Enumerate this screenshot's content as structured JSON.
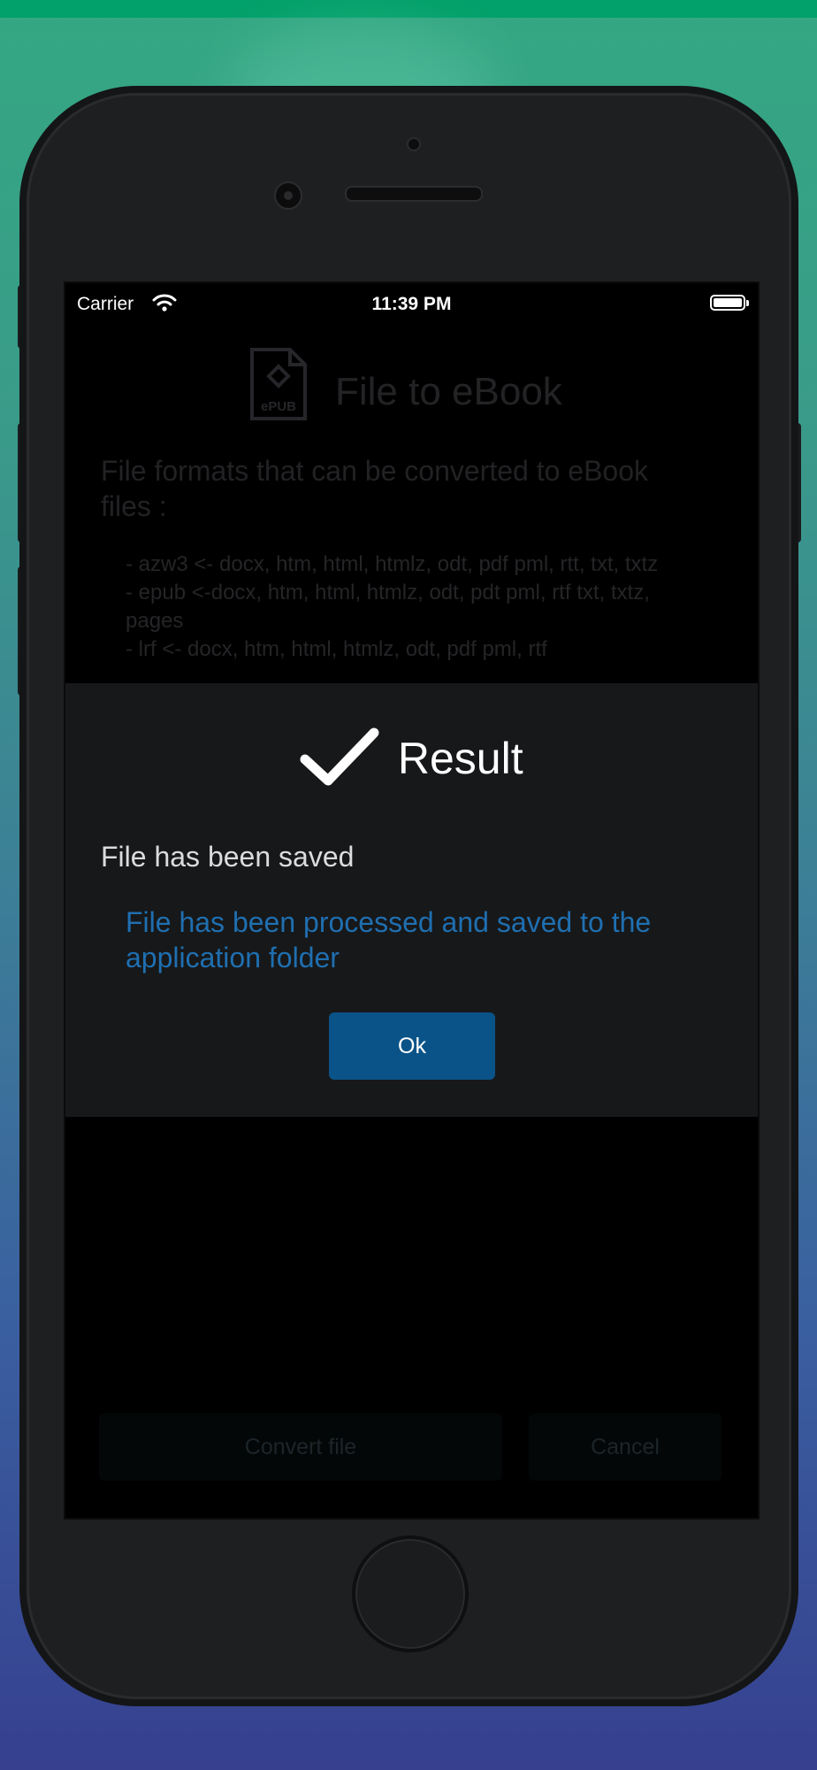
{
  "status_bar": {
    "carrier": "Carrier",
    "time": "11:39 PM",
    "battery_level": 1.0
  },
  "app": {
    "icon_label": "ePUB",
    "title": "File to eBook",
    "intro": "File formats that can be converted to eBook files :",
    "formats": [
      "- azw3 <- docx, htm, html, htmlz, odt, pdf pml, rtt, txt, txtz",
      "- epub <-docx, htm, html, htmlz, odt, pdt pml, rtf txt, txtz, pages",
      "- lrf <- docx, htm, html, htmlz, odt, pdf pml, rtf"
    ],
    "convert_label": "Convert file",
    "cancel_label": "Cancel"
  },
  "dialog": {
    "title": "Result",
    "message_title": "File has been saved",
    "message_detail": "File has been processed and saved to the application folder",
    "ok_label": "Ok",
    "check_color": "#ffffff",
    "detail_color": "#1f6fb0",
    "button_color": "#0a5388"
  }
}
